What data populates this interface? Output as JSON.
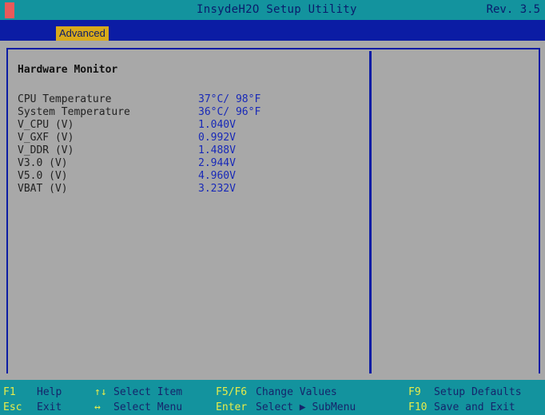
{
  "header": {
    "title": "InsydeH2O Setup Utility",
    "revision": "Rev. 3.5"
  },
  "menu": {
    "tabs": [
      {
        "label": "Advanced",
        "active": true
      }
    ]
  },
  "panel": {
    "title": "Hardware Monitor",
    "rows": [
      {
        "label": "CPU Temperature",
        "value": "37°C/ 98°F"
      },
      {
        "label": "System Temperature",
        "value": "36°C/ 96°F"
      },
      {
        "label": "V_CPU (V)",
        "value": "1.040V"
      },
      {
        "label": "V_GXF (V)",
        "value": "0.992V"
      },
      {
        "label": "V_DDR (V)",
        "value": "1.488V"
      },
      {
        "label": "V3.0 (V)",
        "value": "2.944V"
      },
      {
        "label": "V5.0 (V)",
        "value": "4.960V"
      },
      {
        "label": "VBAT (V)",
        "value": "3.232V"
      }
    ]
  },
  "footer": {
    "f1_key": "F1",
    "f1_action": "Help",
    "esc_key": "Esc",
    "esc_action": "Exit",
    "select_item_key": "↑↓",
    "select_item_action": "Select Item",
    "select_menu_key": "↔",
    "select_menu_action": "Select Menu",
    "f5f6_key": "F5/F6",
    "f5f6_action": "Change Values",
    "enter_key": "Enter",
    "enter_action": "Select ▶ SubMenu",
    "f9_key": "F9",
    "f9_action": "Setup Defaults",
    "f10_key": "F10",
    "f10_action": "Save and Exit"
  },
  "colors": {
    "background": "#a8a8a8",
    "title_bar": "#13939e",
    "menu_bar": "#0b1ca4",
    "active_tab": "#d8aa1a",
    "value_text": "#1829b8",
    "footer_key": "#e7ec4a"
  }
}
